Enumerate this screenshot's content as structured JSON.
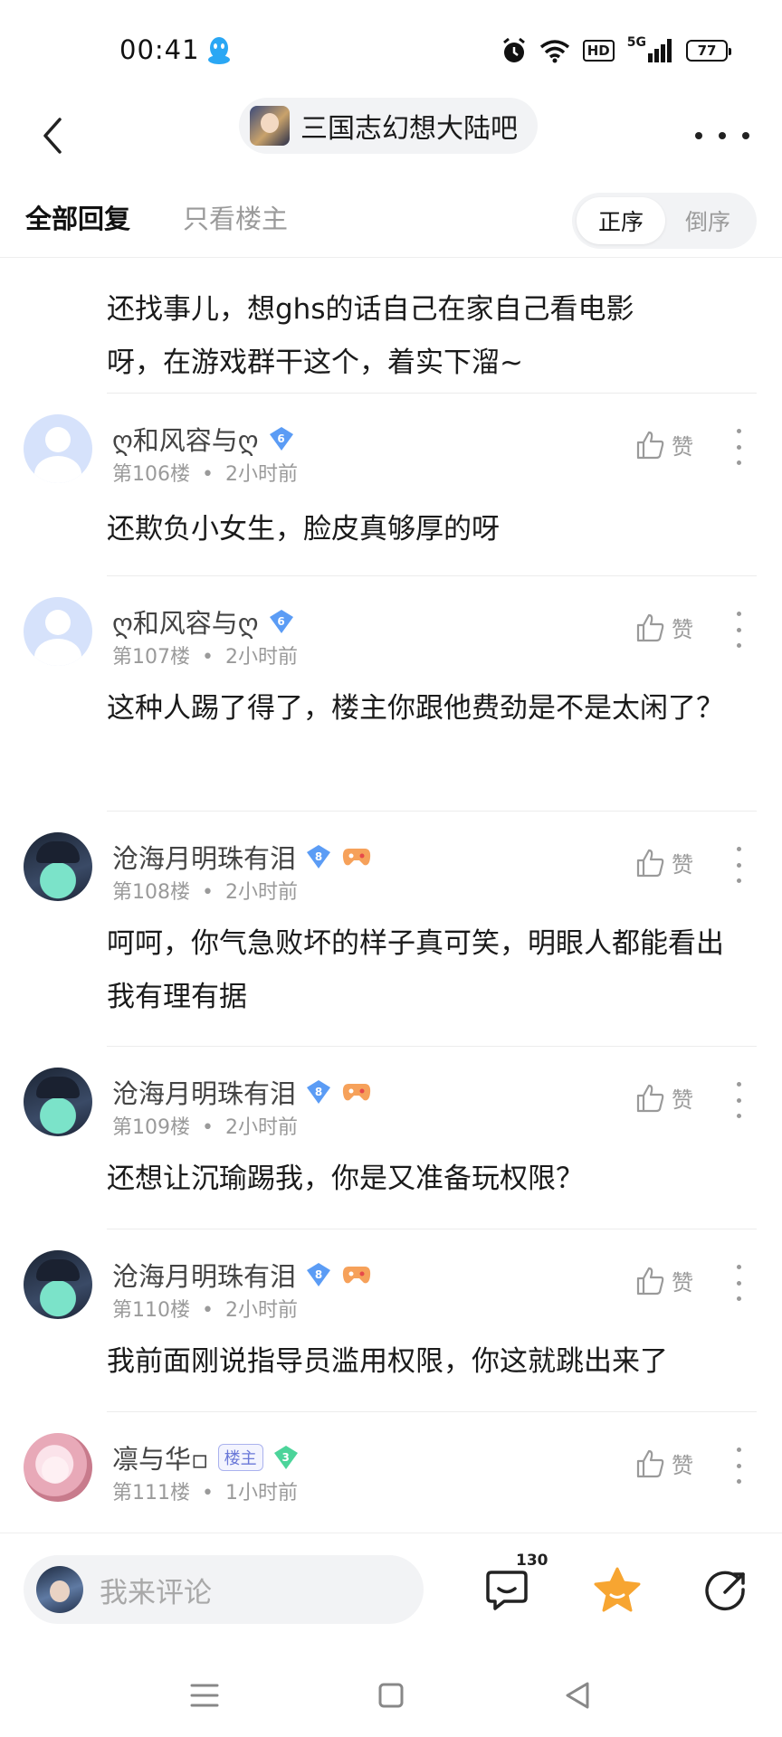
{
  "status_bar": {
    "time": "00:41",
    "icons": [
      "qq-penguin-icon",
      "alarm-icon",
      "wifi-icon",
      "hd-icon",
      "5g-signal-icon",
      "battery-icon"
    ],
    "hd": "HD",
    "network": "5G",
    "battery": "77"
  },
  "header": {
    "forum_name": "三国志幻想大陆吧",
    "back_icon": "chevron-left-icon",
    "more_icon": "more-horizontal-icon"
  },
  "tabs": {
    "all_replies": "全部回复",
    "owner_only": "只看楼主",
    "order_asc": "正序",
    "order_desc": "倒序"
  },
  "partial_reply": {
    "lines": [
      "还找事儿，想ghs的话自己在家自己看电影",
      "呀，在游戏群干这个，着实下溜~"
    ]
  },
  "replies": [
    {
      "username": "ღ和风容与ღ",
      "level": "6",
      "floor": "第106楼",
      "sep": "•",
      "time": "2小时前",
      "like": "赞",
      "text": "还欺负小女生，脸皮真够厚的呀"
    },
    {
      "username": "ღ和风容与ღ",
      "level": "6",
      "floor": "第107楼",
      "sep": "•",
      "time": "2小时前",
      "like": "赞",
      "text": "这种人踢了得了，楼主你跟他费劲是不是太闲了？"
    },
    {
      "username": "沧海月明珠有泪",
      "level": "8",
      "floor": "第108楼",
      "sep": "•",
      "time": "2小时前",
      "like": "赞",
      "text": "呵呵，你气急败坏的样子真可笑，明眼人都能看出我有理有据"
    },
    {
      "username": "沧海月明珠有泪",
      "level": "8",
      "floor": "第109楼",
      "sep": "•",
      "time": "2小时前",
      "like": "赞",
      "text": "还想让沉瑜踢我，你是又准备玩权限？"
    },
    {
      "username": "沧海月明珠有泪",
      "level": "8",
      "floor": "第110楼",
      "sep": "•",
      "time": "2小时前",
      "like": "赞",
      "text": "我前面刚说指导员滥用权限，你这就跳出来了"
    },
    {
      "username": "凛与华▫",
      "owner_badge": "楼主",
      "level": "3",
      "floor": "第111楼",
      "sep": "•",
      "time": "1小时前",
      "like": "赞"
    }
  ],
  "bottom_bar": {
    "placeholder": "我来评论",
    "comment_count": "130",
    "icons": [
      "comment-icon",
      "star-icon",
      "share-icon"
    ],
    "star_color": "#f7a531"
  },
  "colors": {
    "blue_badge": "#5b9cf5",
    "green_badge": "#4cd49a",
    "owner_badge": "#6a78d8",
    "muted_text": "#9a9a9a"
  }
}
